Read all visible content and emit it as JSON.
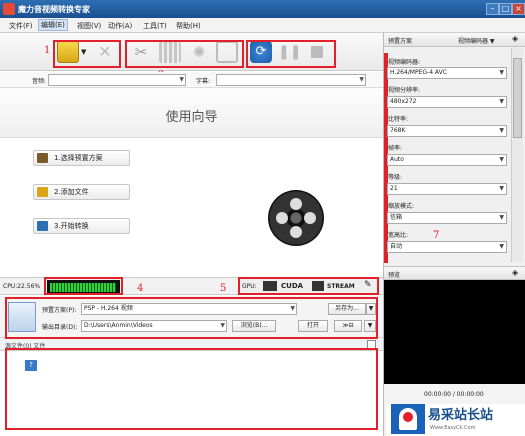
{
  "window": {
    "title": "魔力音视频转换专家"
  },
  "menu": [
    "文件(F)",
    "编辑(E)",
    "视图(V)",
    "动作(A)",
    "工具(T)",
    "帮助(H)"
  ],
  "subrow": {
    "audio_label": "音频:",
    "subtitle_label": "字幕:"
  },
  "wizard": {
    "title": "使用向导",
    "steps": [
      "1.选择预置方案",
      "2.添加文件",
      "3.开始转换"
    ]
  },
  "status": {
    "cpu": "CPU:22.56%",
    "gpu_label": "GPU:",
    "cuda": "CUDA",
    "stream": "STREAM"
  },
  "profile": {
    "preset_label": "预置方案(P):",
    "preset_value": "PSP - H.264 视频",
    "save_as": "另存为...",
    "output_label": "输出目录(D):",
    "output_value": "D:\\Users\\Anmin\\Videos",
    "browse": "浏览(B)...",
    "open": "打开"
  },
  "queue": {
    "header": "源文件(0) 文件"
  },
  "right_panel": {
    "title": "预置方案",
    "encoder_combo": "视频编码器 ▼",
    "fields": [
      {
        "label": "视频编码器:",
        "value": "H.264/MPEG-4 AVC"
      },
      {
        "label": "视频分辨率:",
        "value": "480x272"
      },
      {
        "label": "比特率:",
        "value": "768K"
      },
      {
        "label": "帧率:",
        "value": "Auto"
      },
      {
        "label": "等级:",
        "value": "21"
      },
      {
        "label": "缩放模式:",
        "value": "信箱"
      },
      {
        "label": "宽高比:",
        "value": "自动"
      }
    ]
  },
  "preview": {
    "title": "预览",
    "time": "00:00:00 / 00:00:00"
  },
  "watermark": {
    "text": "易采站长站",
    "url": "Www.EasyCk.Com"
  },
  "annotations": [
    "1",
    "2",
    "3",
    "4",
    "5",
    "7"
  ],
  "colors": {
    "accent": "#e2202a",
    "title": "#1a4f8e"
  }
}
